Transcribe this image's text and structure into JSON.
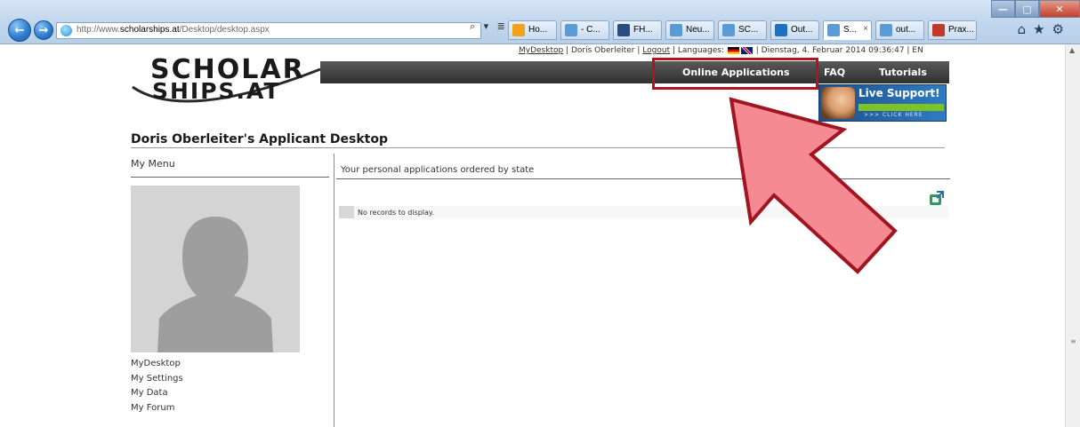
{
  "browser": {
    "url_prefix": "http://www.",
    "url_domain": "scholarships.at",
    "url_path": "/Desktop/desktop.aspx",
    "address_tools": "⌕ ▾ ≣ ↻ ✕",
    "tabs": [
      {
        "label": "Ho...",
        "color": "#f2a21a",
        "active": false
      },
      {
        "label": "- C...",
        "color": "#5b9bd5",
        "active": false
      },
      {
        "label": "FH...",
        "color": "#2b4c7e",
        "active": false
      },
      {
        "label": "Neu...",
        "color": "#5b9bd5",
        "active": false
      },
      {
        "label": "SC...",
        "color": "#5b9bd5",
        "active": false
      },
      {
        "label": "Out...",
        "color": "#1f6fc5",
        "active": false
      },
      {
        "label": "S...",
        "color": "#5b9bd5",
        "active": true
      },
      {
        "label": "out...",
        "color": "#5b9bd5",
        "active": false
      },
      {
        "label": "Prax...",
        "color": "#c0392b",
        "active": false
      }
    ],
    "tab_close": "×",
    "back_icon": "←",
    "forward_icon": "→",
    "window_min": "—",
    "window_max": "▢",
    "window_close": "✕",
    "chrome_icons": "⌂★⚙"
  },
  "header": {
    "mydesktop_link": "MyDesktop",
    "user_name": "| Doris Oberleiter |",
    "logout_link": "Logout",
    "languages_label": "| Languages:",
    "date_text": "| Dienstag, 4. Februar 2014 09:36:47 | EN",
    "logo_line1": "SCHOLAR",
    "logo_line2": "SHIPS.AT",
    "menu": {
      "online_applications": "Online Applications",
      "faq": "FAQ",
      "tutorials": "Tutorials"
    },
    "live_support": {
      "title": "Live Support!",
      "click_here": ">>> CLICK HERE"
    }
  },
  "page": {
    "title": "Doris Oberleiter's Applicant Desktop",
    "my_menu": {
      "heading": "My Menu",
      "items": [
        "MyDesktop",
        "My Settings",
        "My Data",
        "My Forum"
      ]
    },
    "applications": {
      "heading": "Your personal applications ordered by state",
      "empty_text": "No records to display."
    }
  },
  "colors": {
    "highlight": "#b4121d",
    "arrow_fill": "#f58a92",
    "arrow_stroke": "#a01520",
    "menubar": "#3a3a3a"
  }
}
